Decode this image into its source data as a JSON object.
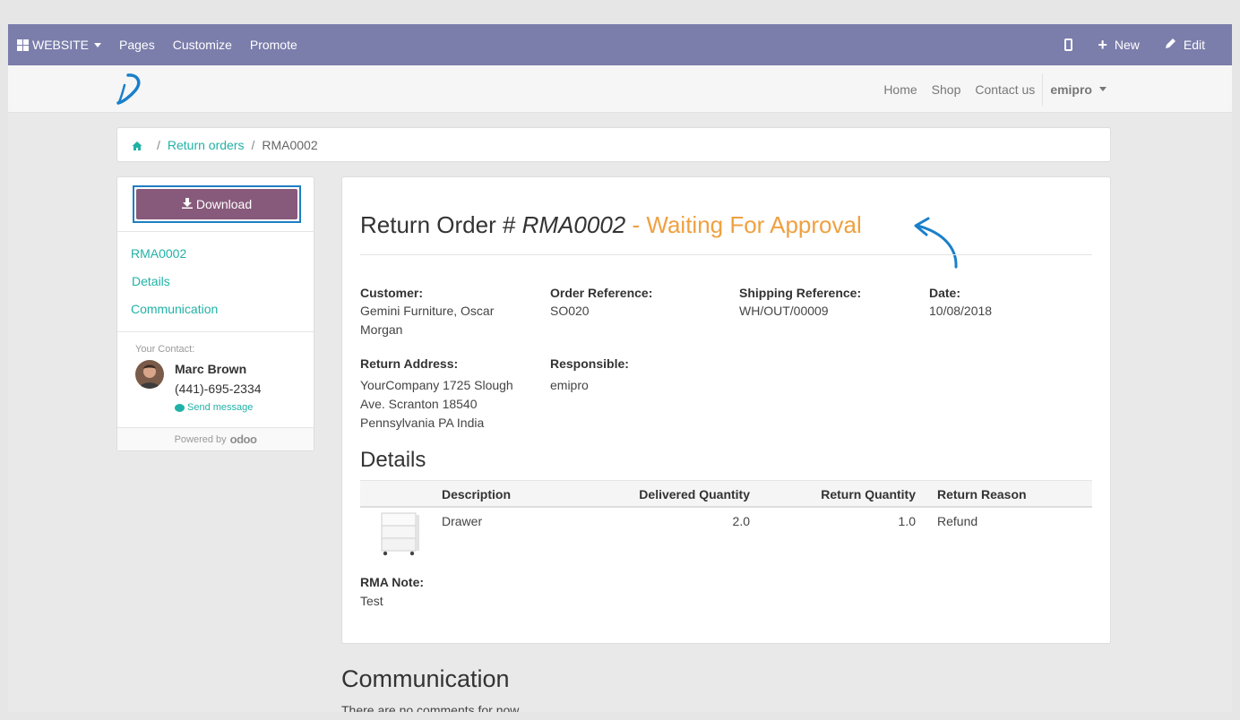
{
  "topbar": {
    "website_label": "WEBSITE",
    "menu": [
      "Pages",
      "Customize",
      "Promote"
    ],
    "new_label": "New",
    "edit_label": "Edit"
  },
  "site_nav": {
    "links": [
      "Home",
      "Shop",
      "Contact us"
    ],
    "user": "emipro"
  },
  "breadcrumb": {
    "parent": "Return orders",
    "current": "RMA0002"
  },
  "sidebar": {
    "download_label": "Download",
    "links": [
      "RMA0002",
      "Details",
      "Communication"
    ],
    "contact_title": "Your Contact:",
    "contact_name": "Marc Brown",
    "contact_phone": "(441)-695-2334",
    "send_message": "Send message",
    "powered_by": "Powered by",
    "powered_brand": "odoo"
  },
  "order": {
    "title_prefix": "Return Order #",
    "reference": "RMA0002",
    "state": "- Waiting For Approval",
    "fields": {
      "customer_label": "Customer:",
      "customer_line1": "Gemini Furniture, Oscar",
      "customer_line2": "Morgan",
      "order_ref_label": "Order Reference:",
      "order_ref": "SO020",
      "shipping_ref_label": "Shipping Reference:",
      "shipping_ref": "WH/OUT/00009",
      "date_label": "Date:",
      "date": "10/08/2018",
      "return_address_label": "Return Address:",
      "return_address_line1": "YourCompany 1725 Slough",
      "return_address_line2": "Ave. Scranton 18540",
      "return_address_line3": "Pennsylvania PA India",
      "responsible_label": "Responsible:",
      "responsible": "emipro"
    },
    "details_title": "Details",
    "table": {
      "headers": [
        "Description",
        "Delivered Quantity",
        "Return Quantity",
        "Return Reason"
      ],
      "rows": [
        {
          "description": "Drawer",
          "delivered": "2.0",
          "returned": "1.0",
          "reason": "Refund"
        }
      ]
    },
    "note_label": "RMA Note:",
    "note": "Test"
  },
  "communication": {
    "title": "Communication",
    "text": "There are no comments for now."
  },
  "colors": {
    "topbar": "#7b7dab",
    "link": "#21b2a6",
    "primary_button": "#875a7b",
    "state": "#f0a040"
  }
}
